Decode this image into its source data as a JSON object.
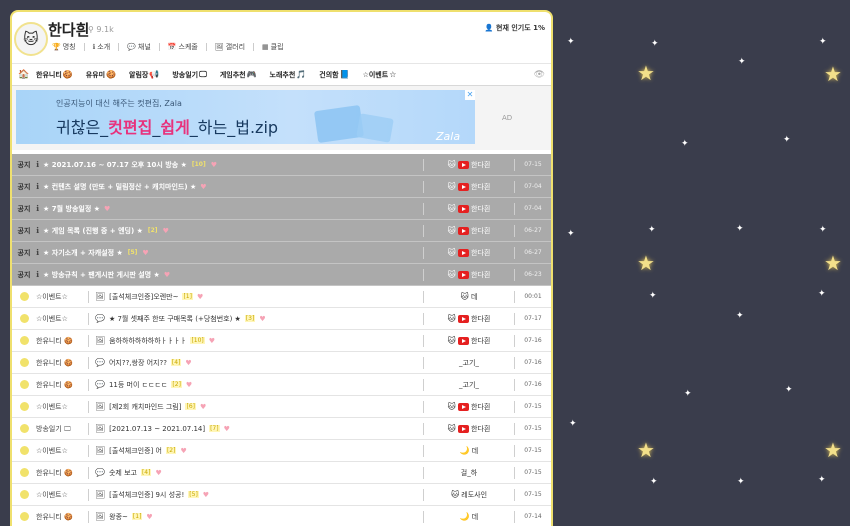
{
  "header": {
    "title": "한다흰",
    "subscribers": "9.1k",
    "links": [
      {
        "icon": "trophy-icon",
        "glyph": "🏆",
        "label": "명칭"
      },
      {
        "icon": "info-icon",
        "glyph": "ℹ",
        "label": "소개"
      },
      {
        "icon": "chat-icon",
        "glyph": "💬",
        "label": "채널"
      },
      {
        "icon": "calendar-icon",
        "glyph": "📅",
        "label": "스케줄"
      },
      {
        "icon": "image-icon",
        "glyph": "🖼",
        "label": "갤러리"
      },
      {
        "icon": "grid-icon",
        "glyph": "▦",
        "label": "클립"
      }
    ],
    "live_rank": "현재 인기도 1%"
  },
  "menu": {
    "home_icon": "home-icon",
    "items": [
      {
        "label": "한유니티",
        "glyph": "🍪"
      },
      {
        "label": "유유미",
        "glyph": "🍪"
      },
      {
        "label": "알림장",
        "glyph": "📢"
      },
      {
        "label": "방송일기",
        "glyph": "🖵"
      },
      {
        "label": "게임추천",
        "glyph": "🎮"
      },
      {
        "label": "노래추천",
        "glyph": "🎵"
      },
      {
        "label": "건의함",
        "glyph": "📘"
      },
      {
        "label": "☆이벤트",
        "glyph": "☆"
      }
    ]
  },
  "ad": {
    "small": "인공지능이 대신 해주는 컷편집, Zala",
    "big_pre": "귀찮은_",
    "big_hl1": "컷편집",
    "big_mid": "_",
    "big_hl2": "쉽게",
    "big_post": "_하는_법.zip",
    "brand": "Zala",
    "label": "AD",
    "close": "✕"
  },
  "rows": [
    {
      "notice": true,
      "badge": "공지",
      "title": "★ 2021.07.16 ~ 07.17 오후 10시 방송 ★",
      "comments": "[10]",
      "author": "한다흰",
      "yt": true,
      "date": "07-15"
    },
    {
      "notice": true,
      "badge": "공지",
      "title": "★ 컨텐츠 설명 (만또 + 밀림정산 + 캐치마인드) ★",
      "comments": "",
      "author": "한다흰",
      "yt": true,
      "date": "07-04"
    },
    {
      "notice": true,
      "badge": "공지",
      "title": "★ 7월 방송일정 ★",
      "comments": "",
      "author": "한다흰",
      "yt": true,
      "date": "07-04"
    },
    {
      "notice": true,
      "badge": "공지",
      "title": "★ 게임 목록 (진행 중 + 엔딩) ★",
      "comments": "[2]",
      "author": "한다흰",
      "yt": true,
      "date": "06-27"
    },
    {
      "notice": true,
      "badge": "공지",
      "title": "★ 자기소개 + 자캐설정 ★",
      "comments": "[5]",
      "author": "한다흰",
      "yt": true,
      "date": "06-27"
    },
    {
      "notice": true,
      "badge": "공지",
      "title": "★ 방송규칙 + 팬게시판 게시판 설명 ★",
      "comments": "",
      "author": "한다흰",
      "yt": true,
      "date": "06-23"
    },
    {
      "notice": false,
      "cat": "☆이벤트☆",
      "ticon": "🖼",
      "title": "[출석체크인증]오렌만~",
      "comments": "[1]",
      "author": "데",
      "a_glyph": "🐱",
      "yt": false,
      "date": "00:01"
    },
    {
      "notice": false,
      "cat": "☆이벤트☆",
      "ticon": "💬",
      "title": "★ 7월 셋째주 한또 구매목록 (+당첨번호) ★",
      "comments": "[3]",
      "author": "한다흰",
      "a_glyph": "🐱",
      "yt": true,
      "date": "07-17"
    },
    {
      "notice": false,
      "cat": "한유니티 🍪",
      "ticon": "🖼",
      "title": "움하하하하하하하ㅏㅏㅏㅏ",
      "comments": "[10]",
      "author": "한다흰",
      "a_glyph": "🐱",
      "yt": true,
      "date": "07-16"
    },
    {
      "notice": false,
      "cat": "한유니티 🍪",
      "ticon": "💬",
      "title": "어지??,쌍장 어지??",
      "comments": "[4]",
      "author": "_고기_",
      "a_glyph": "",
      "yt": false,
      "date": "07-16"
    },
    {
      "notice": false,
      "cat": "한유니티 🍪",
      "ticon": "💬",
      "title": "11등 머이 ㄷㄷㄷㄷ",
      "comments": "[2]",
      "author": "_고기_",
      "a_glyph": "",
      "yt": false,
      "date": "07-16"
    },
    {
      "notice": false,
      "cat": "☆이벤트☆",
      "ticon": "🖼",
      "title": "[제2회 캐치마인드 그림]",
      "comments": "[6]",
      "author": "한다흰",
      "a_glyph": "🐱",
      "yt": true,
      "date": "07-15"
    },
    {
      "notice": false,
      "cat": "방송일기 🖵",
      "ticon": "🖼",
      "title": "[2021.07.13 ~ 2021.07.14]",
      "comments": "[7]",
      "author": "한다흰",
      "a_glyph": "🐱",
      "yt": true,
      "date": "07-15"
    },
    {
      "notice": false,
      "cat": "☆이벤트☆",
      "ticon": "🖼",
      "title": "[출석체크인증] 어",
      "comments": "[2]",
      "author": "데",
      "a_glyph": "🌙",
      "yt": false,
      "date": "07-15"
    },
    {
      "notice": false,
      "cat": "한유니티 🍪",
      "ticon": "💬",
      "title": "숫제 보고",
      "comments": "[4]",
      "author": "걸_하",
      "a_glyph": "",
      "yt": false,
      "date": "07-15"
    },
    {
      "notice": false,
      "cat": "☆이벤트☆",
      "ticon": "🖼",
      "title": "[출석체크인증] 9시 성공!",
      "comments": "[5]",
      "author": "레도사인",
      "a_glyph": "🐱",
      "yt": false,
      "date": "07-15"
    },
    {
      "notice": false,
      "cat": "한유니티 🍪",
      "ticon": "🖼",
      "title": "왕종~",
      "comments": "[1]",
      "author": "데",
      "a_glyph": "🌙",
      "yt": false,
      "date": "07-14"
    }
  ]
}
